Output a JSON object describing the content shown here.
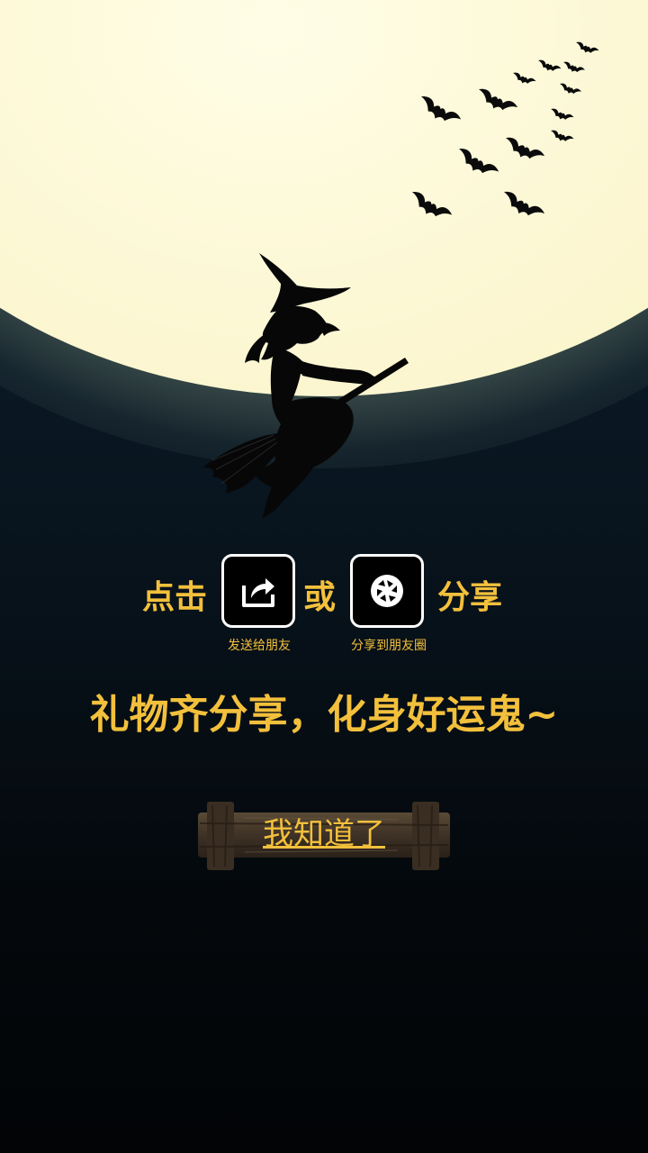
{
  "share": {
    "prefix": "点击",
    "or": "或",
    "suffix": "分享",
    "send_friend_icon": "share-arrow-icon",
    "send_friend_caption": "发送给朋友",
    "moments_icon": "camera-aperture-icon",
    "moments_caption": "分享到朋友圈"
  },
  "tagline": "礼物齐分享，化身好运鬼~",
  "button": {
    "label": "我知道了"
  },
  "colors": {
    "accent": "#f3c03c",
    "moon": "#fbf6cf",
    "background_top": "#0f2230",
    "background_bottom": "#020406"
  }
}
